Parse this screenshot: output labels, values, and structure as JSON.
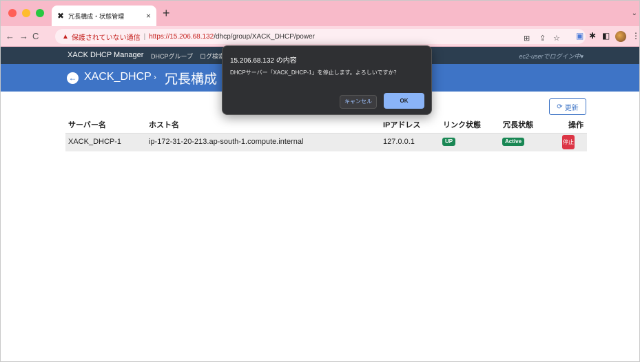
{
  "browser": {
    "tab_title": "冗長構成・状態管理",
    "tab_close": "×",
    "new_tab": "+",
    "tab_menu": "⌄",
    "warning_text": "保護されていない通信",
    "url_scheme_host": "https://15.206.68.132",
    "url_path": "/dhcp/group/XACK_DHCP/power"
  },
  "navbar": {
    "brand": "XACK DHCP Manager",
    "links": [
      "DHCPグループ",
      "ログ検索"
    ],
    "user": "ec2-userでログイン中▾"
  },
  "header": {
    "title": "XACK_DHCP",
    "separator": "›",
    "subtitle": "冗長構成"
  },
  "refresh_label": "更新",
  "table": {
    "columns": [
      "サーバー名",
      "ホスト名",
      "IPアドレス",
      "リンク状態",
      "冗長状態",
      "操作"
    ],
    "rows": [
      {
        "server": "XACK_DHCP-1",
        "host": "ip-172-31-20-213.ap-south-1.compute.internal",
        "ip": "127.0.0.1",
        "link": "UP",
        "redundancy": "Active",
        "action": "停止"
      }
    ]
  },
  "dialog": {
    "title": "15.206.68.132 の内容",
    "message": "DHCPサーバー「XACK_DHCP-1」を停止します。よろしいですか？",
    "cancel": "キャンセル",
    "ok": "OK"
  }
}
